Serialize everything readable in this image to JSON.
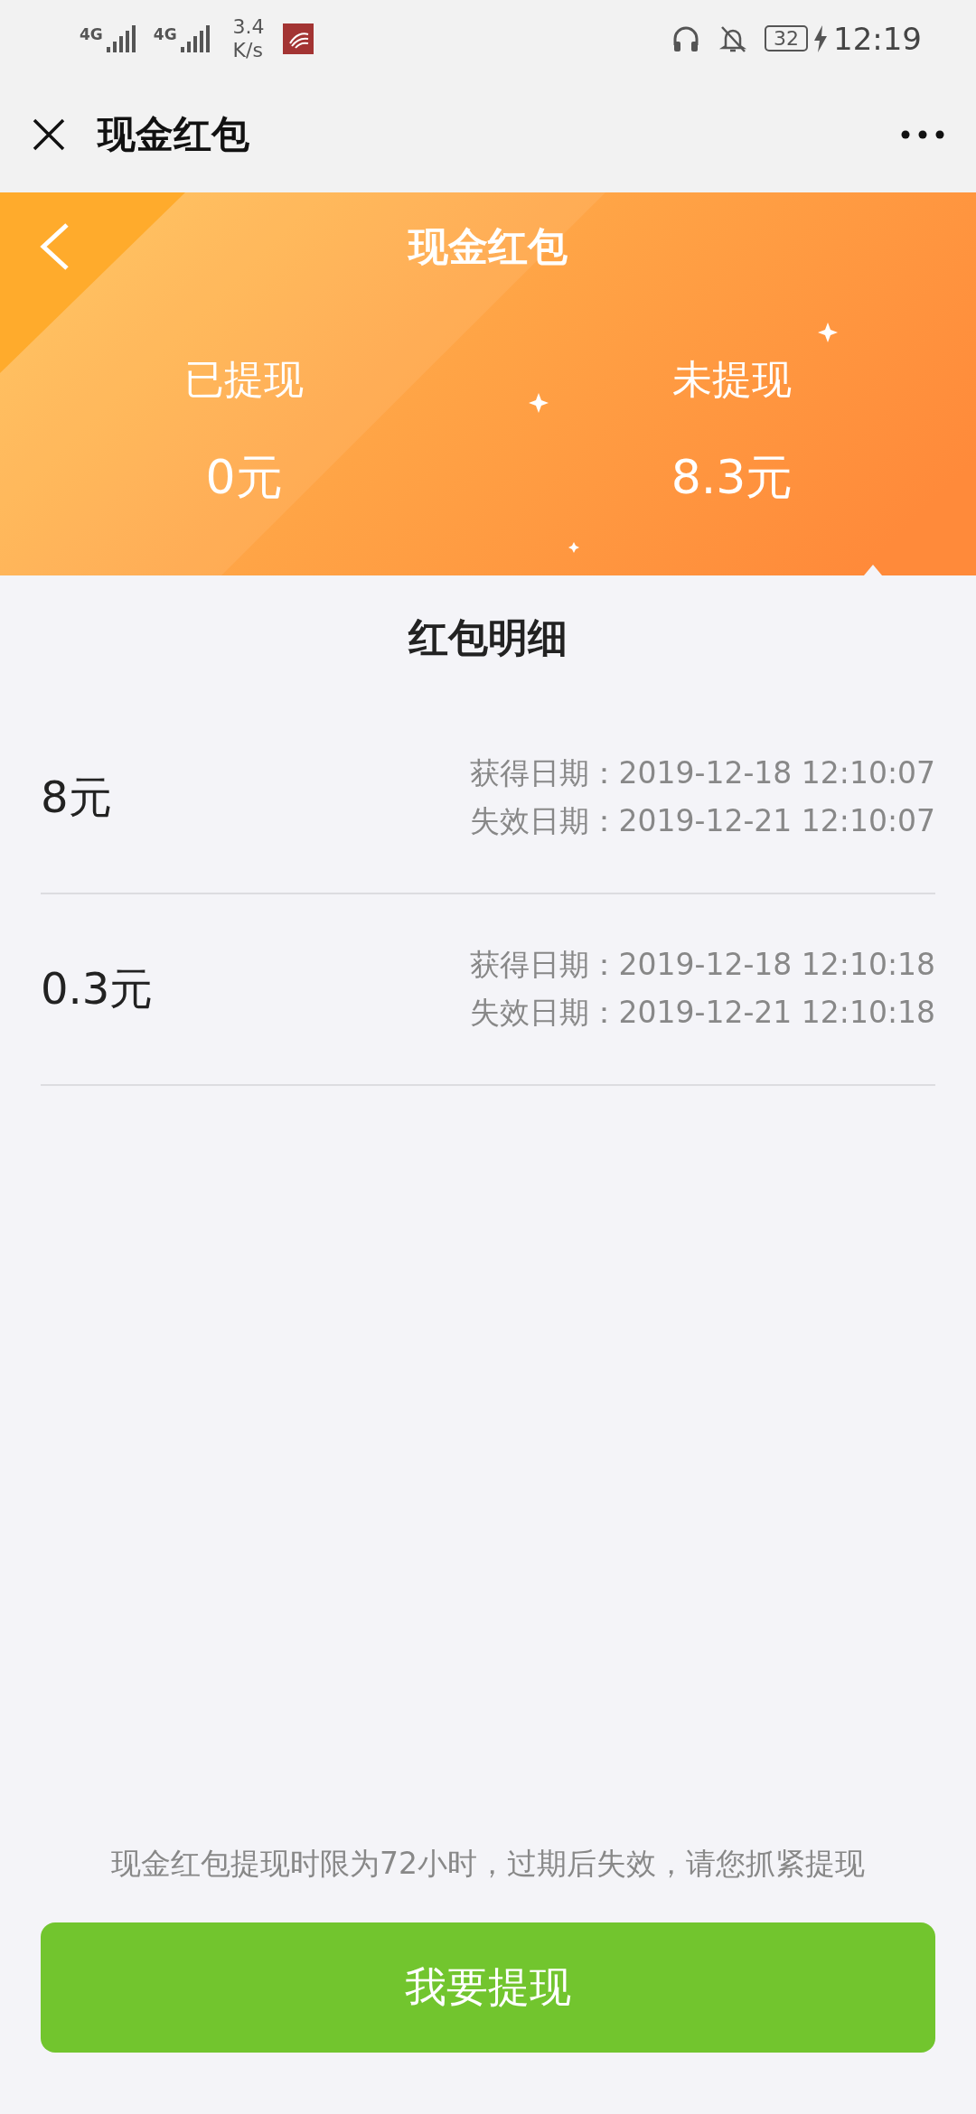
{
  "status_bar": {
    "networks": [
      "4G",
      "4G"
    ],
    "speed_value": "3.4",
    "speed_unit": "K/s",
    "battery": "32",
    "time": "12:19"
  },
  "nav_bar": {
    "title": "现金红包"
  },
  "banner": {
    "title": "现金红包",
    "stats": [
      {
        "label": "已提现",
        "value": "0元"
      },
      {
        "label": "未提现",
        "value": "8.3元"
      }
    ]
  },
  "section_title": "红包明细",
  "records": [
    {
      "amount": "8元",
      "obtained": "获得日期：2019-12-18 12:10:07",
      "expires": "失效日期：2019-12-21 12:10:07"
    },
    {
      "amount": "0.3元",
      "obtained": "获得日期：2019-12-18 12:10:18",
      "expires": "失效日期：2019-12-21 12:10:18"
    }
  ],
  "notice": "现金红包提现时限为72小时，过期后失效，请您抓紧提现",
  "withdraw_button": "我要提现"
}
